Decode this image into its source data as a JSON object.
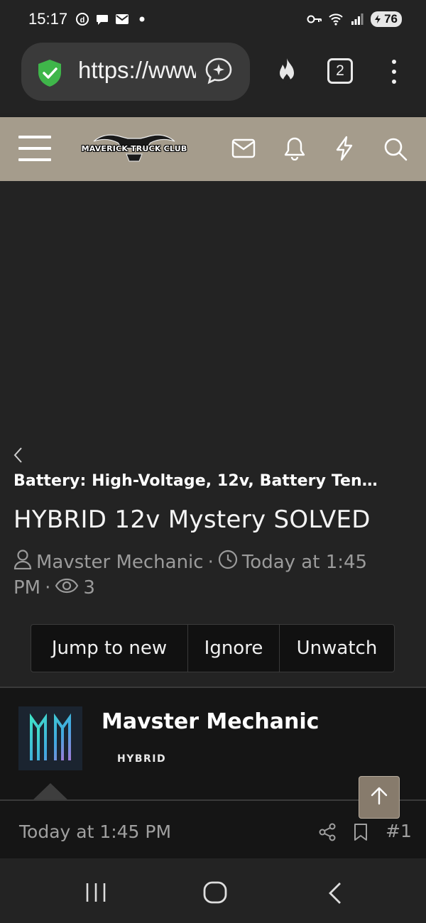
{
  "status_bar": {
    "time": "15:17",
    "battery": "76",
    "left_icons": [
      "data-saver-icon",
      "chat-bubble-icon",
      "mail-icon",
      "dot-icon"
    ],
    "right_icons": [
      "key-icon",
      "wifi-icon",
      "signal-icon",
      "battery-icon"
    ]
  },
  "browser": {
    "url": "https://www.mavericktruckclub.com",
    "tab_count": "2",
    "icons": [
      "shield-check-icon",
      "ai-assistant-icon",
      "flame-icon",
      "tabs-icon",
      "more-vertical-icon"
    ]
  },
  "site_header": {
    "logo_text": "MAVERICK TRUCK CLUB",
    "background": "#a59c8c",
    "icons": [
      "menu-icon",
      "mail-icon",
      "bell-icon",
      "bolt-icon",
      "search-icon"
    ]
  },
  "thread": {
    "breadcrumb": "Battery: High-Voltage, 12v, Battery Ten…",
    "title": "HYBRID 12v Mystery SOLVED",
    "author": "Mavster Mechanic",
    "separator": "·",
    "date": "Today at 1:45",
    "date_suffix": "PM",
    "views": "3",
    "actions": {
      "jump_to_new": "Jump to new",
      "ignore": "Ignore",
      "unwatch": "Unwatch"
    }
  },
  "post": {
    "author": "Mavster Mechanic",
    "badge": "HYBRID",
    "timestamp": "Today at 1:45 PM",
    "number": "#1"
  },
  "nav": {
    "icons": [
      "recents-icon",
      "home-icon",
      "back-icon"
    ]
  }
}
